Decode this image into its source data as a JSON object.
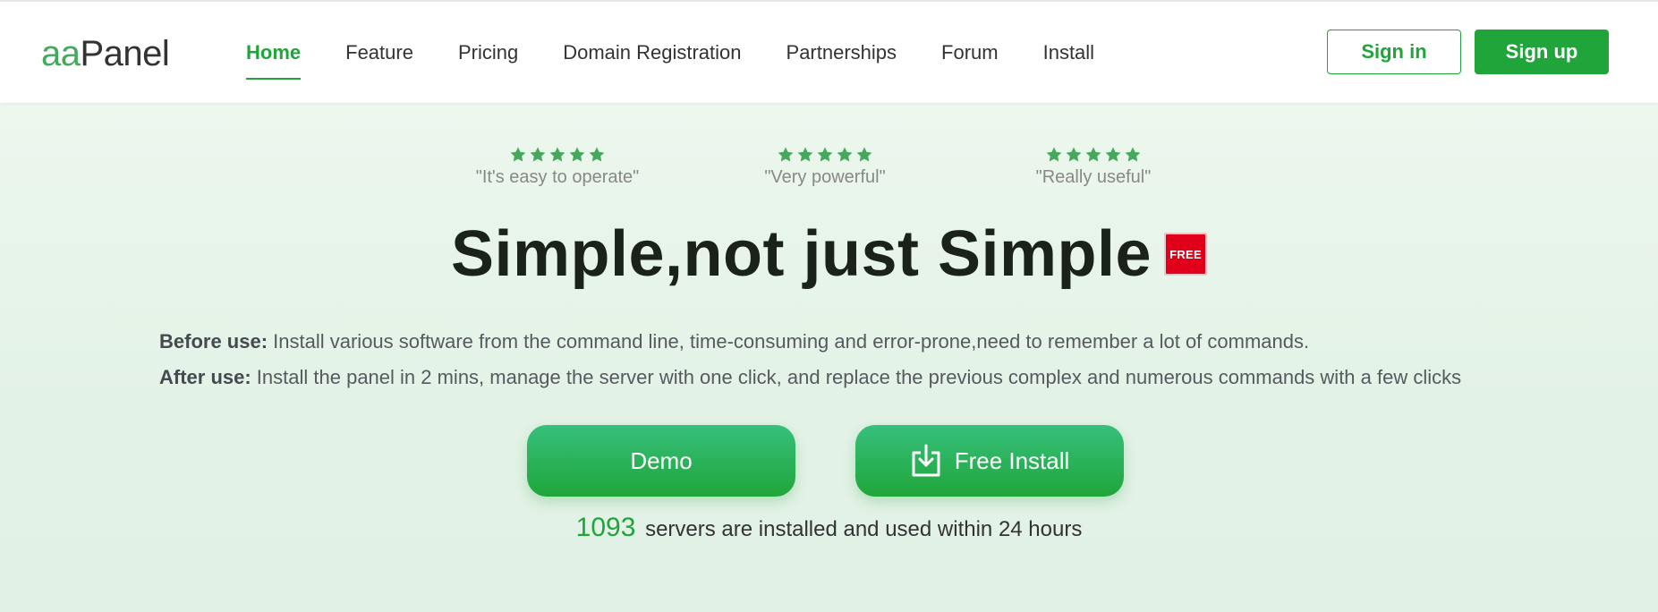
{
  "header": {
    "logo_part1": "aa",
    "logo_part2": "Panel",
    "nav": [
      {
        "label": "Home",
        "active": true
      },
      {
        "label": "Feature"
      },
      {
        "label": "Pricing"
      },
      {
        "label": "Domain Registration"
      },
      {
        "label": "Partnerships"
      },
      {
        "label": "Forum"
      },
      {
        "label": "Install"
      }
    ],
    "signin_label": "Sign in",
    "signup_label": "Sign up"
  },
  "hero": {
    "reviews": [
      {
        "rating": 5,
        "quote": "\"It's easy to operate\""
      },
      {
        "rating": 5,
        "quote": "\"Very powerful\""
      },
      {
        "rating": 5,
        "quote": "\"Really useful\""
      }
    ],
    "headline": "Simple,not just Simple",
    "badge": "FREE",
    "before_label": "Before use:",
    "before_text": " Install various software from the command line, time-consuming and error-prone,need to remember a lot of commands.",
    "after_label": "After use:",
    "after_text": " Install the panel in 2 mins, manage the server with one click, and replace the previous complex and numerous commands with a few clicks",
    "demo_label": "Demo",
    "install_label": "Free Install",
    "install_icon": "download-icon",
    "server_count": "1093",
    "server_text": "servers are installed and used within 24 hours"
  },
  "colors": {
    "brand_green": "#20a53a",
    "logo_green": "#45a85b",
    "badge_red": "#e1001a",
    "hero_bg": "#e3f2e6"
  }
}
